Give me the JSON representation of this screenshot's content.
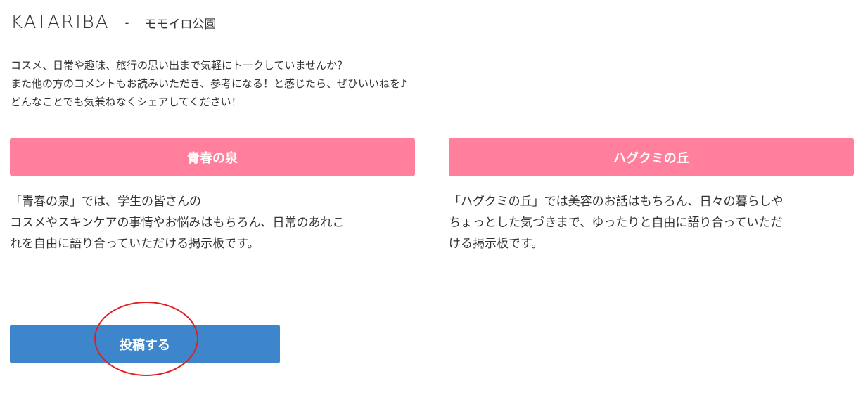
{
  "header": {
    "brand": "KATARIBA",
    "separator": "-",
    "page_name": "モモイロ公園"
  },
  "intro": {
    "lines": [
      "コスメ、日常や趣味、旅行の思い出まで気軽にトークしていませんか？",
      "また他の方のコメントもお読みいただき、参考になる！と感じたら、ぜひいいねを♪",
      "どんなことでも気兼ねなくシェアしてください！"
    ]
  },
  "boards": [
    {
      "title": "青春の泉",
      "description_lines": [
        "「青春の泉」では、学生の皆さんの",
        "コスメやスキンケアの事情やお悩みはもちろん、日常のあれこ",
        "れを自由に語り合っていただける掲示板です。"
      ]
    },
    {
      "title": "ハグクミの丘",
      "description_lines": [
        "「ハグクミの丘」では美容のお話はもちろん、日々の暮らしや",
        "ちょっとした気づきまで、ゆったりと自由に語り合っていただ",
        "ける掲示板です。"
      ]
    }
  ],
  "post_button": {
    "label": "投稿する"
  },
  "colors": {
    "board_title_bg": "#ff7f9c",
    "post_button_bg": "#3d86cc",
    "annotation_circle": "#e02020"
  }
}
